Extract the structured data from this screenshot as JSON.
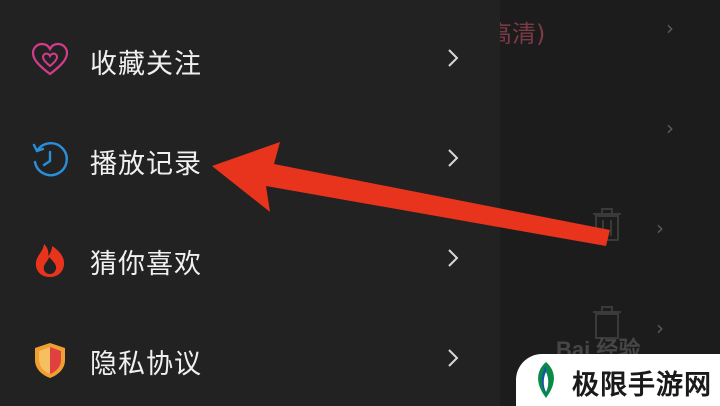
{
  "background": {
    "header_text": "高清)"
  },
  "menu": {
    "items": [
      {
        "label": "收藏关注",
        "icon": "heart-icon"
      },
      {
        "label": "播放记录",
        "icon": "history-clock-icon"
      },
      {
        "label": "猜你喜欢",
        "icon": "flame-icon"
      },
      {
        "label": "隐私协议",
        "icon": "shield-icon"
      }
    ]
  },
  "watermarks": {
    "baidu": "Bai 经验",
    "site": "极限手游网"
  },
  "colors": {
    "drawer_bg": "#222222",
    "arrow": "#e8341c",
    "heart": "#d23c8c",
    "clock": "#2a8fd8",
    "flame": "#e8341c",
    "shield_orange": "#f0a030",
    "shield_red": "#e04040"
  }
}
